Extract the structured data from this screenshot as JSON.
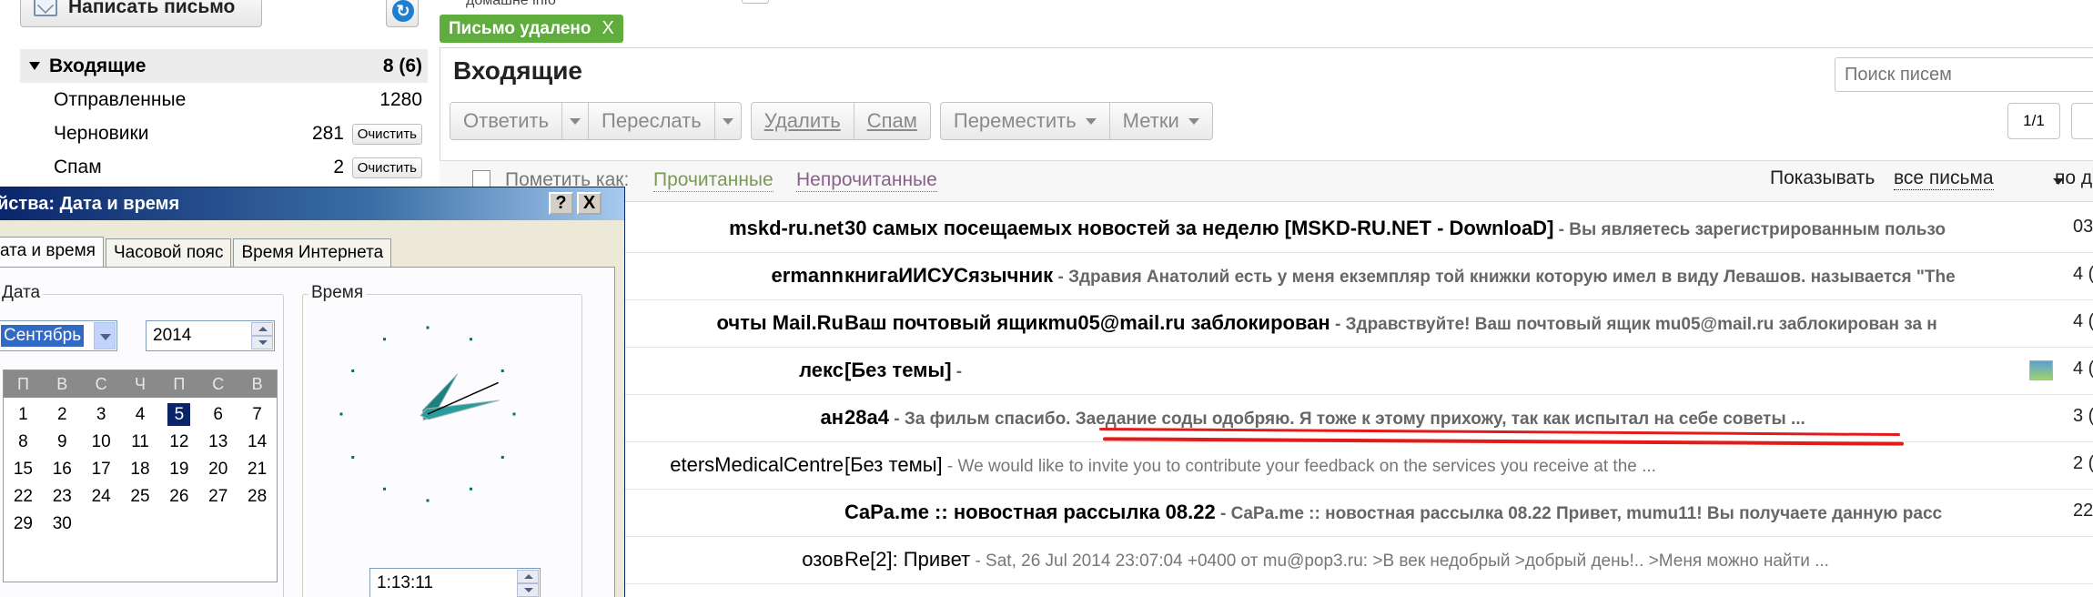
{
  "sidebar": {
    "compose_label": "Написать письмо",
    "refresh_icon": "↻",
    "folders": [
      {
        "name": "Входящие",
        "count": "8 (6)"
      },
      {
        "name": "Отправленные",
        "count": "1280"
      },
      {
        "name": "Черновики",
        "count": "281",
        "action": "Очистить"
      },
      {
        "name": "Спам",
        "count": "2",
        "action": "Очистить"
      }
    ]
  },
  "notice": {
    "text": "Письмо удалено",
    "close": "X"
  },
  "top_sender_fragment": "домашне info",
  "main": {
    "title": "Входящие",
    "search_placeholder": "Поиск писем",
    "toolbar": {
      "reply": "Ответить",
      "forward": "Переслать",
      "delete": "Удалить",
      "spam": "Спам",
      "move": "Переместить",
      "labels": "Метки"
    },
    "pager": "1/1",
    "markbar": {
      "mark_as": "Пометить как:",
      "read": "Прочитанные",
      "unread": "Непрочитанные",
      "show_label": "Показывать",
      "show_value": "все письма",
      "sort_fragment": "по д"
    },
    "messages": [
      {
        "from": "mskd-ru.net",
        "subject": "30 самых посещаемых новостей за неделю [MSKD-RU.NET - DownloaD]",
        "snippet": " - Вы являетесь зарегистрированным пользо",
        "date": "03",
        "unread": true
      },
      {
        "from": "ermann",
        "subject": "книгаИИСУСязычник",
        "snippet": " - Здравия Анатолий есть у меня екземпляр той книжки которую имел в виду Левашов. называется \"The",
        "date": "4 (",
        "unread": true
      },
      {
        "from": "очты Mail.Ru",
        "subject": "Ваш почтовый ящикmu05@mail.ru заблокирован",
        "snippet": " - Здравствуйте! Ваш почтовый ящик mu05@mail.ru заблокирован за н",
        "date": "4 (",
        "unread": true
      },
      {
        "from": "лекс",
        "subject": "[Без темы]",
        "snippet": " -",
        "date": "4 (",
        "unread": true,
        "attachment_icon": "image-thumbnail-icon"
      },
      {
        "from": "ан",
        "subject": "28a4",
        "snippet": " - За фильм спасибо. Заедание соды одобряю. Я тоже к этому прихожу, так как испытал на себе советы ...",
        "date": "3 (",
        "unread": true
      },
      {
        "from": "etersMedicalCentre",
        "subject": "[Без темы]",
        "snippet": " - We would like to invite you to contribute your feedback on the services you receive at the ...",
        "date": "2 (",
        "unread": false
      },
      {
        "from": "",
        "subject": "CaPa.me :: новостная рассылка 08.22",
        "snippet": " - CaPa.me :: новостная рассылка 08.22 Привет, mumu11! Вы получаете данную расс",
        "date": "22",
        "unread": true
      },
      {
        "from": "озов",
        "subject": "Re[2]: Привет",
        "snippet": " - Sat, 26 Jul 2014 23:07:04 +0400 от mu@pop3.ru: >В век недобрый >добрый день!.. >Меня можно найти ...",
        "date": "",
        "unread": false
      }
    ],
    "highlight_color": "#e31b1b"
  },
  "dialog": {
    "title": "йства: Дата и время",
    "help_btn": "?",
    "close_btn": "X",
    "tabs": [
      "ата и время",
      "Часовой пояс",
      "Время Интернета"
    ],
    "date_group": "Дата",
    "time_group": "Время",
    "month": "Сентябрь",
    "year": "2014",
    "weekdays": [
      "П",
      "В",
      "С",
      "Ч",
      "П",
      "С",
      "В"
    ],
    "days": [
      "1",
      "2",
      "3",
      "4",
      "5",
      "6",
      "7",
      "8",
      "9",
      "10",
      "11",
      "12",
      "13",
      "14",
      "15",
      "16",
      "17",
      "18",
      "19",
      "20",
      "21",
      "22",
      "23",
      "24",
      "25",
      "26",
      "27",
      "28",
      "29",
      "30"
    ],
    "selected_day": "5",
    "time": "1:13:11"
  }
}
